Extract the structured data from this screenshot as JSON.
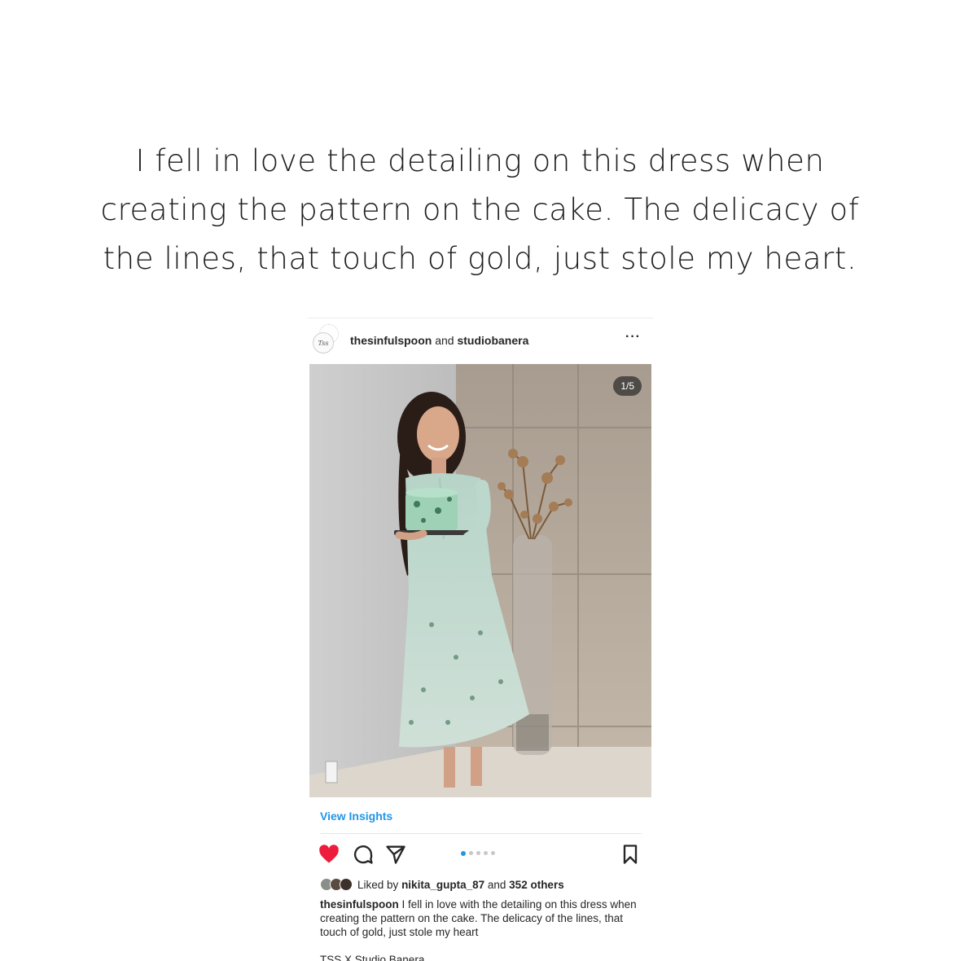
{
  "quote": {
    "text": "I fell in love the detailing on this dress when creating the pattern on the cake. The delicacy of the lines, that touch of gold, just stole my heart."
  },
  "post": {
    "username_primary": "thesinfulspoon",
    "username_joiner": "and",
    "username_secondary": "studiobanera",
    "avatar_text": "Tss",
    "more_icon": "···",
    "slide_counter": "1/5",
    "view_insights": "View Insights",
    "carousel": {
      "total": 5,
      "current": 1
    },
    "likes": {
      "prefix": "Liked by",
      "user": "nikita_gupta_87",
      "joiner": "and",
      "others": "352 others"
    },
    "caption": {
      "username": "thesinfulspoon",
      "text": "I fell in love with the detailing on this dress when creating the pattern on the cake. The delicacy of the lines, that touch of gold, just stole my heart"
    },
    "hashtag_line": "TSS X Studio Banera",
    "icons": {
      "heart": "heart-filled-icon",
      "comment": "comment-icon",
      "share": "send-icon",
      "save": "bookmark-icon"
    }
  },
  "colors": {
    "heart": "#ed1c3b",
    "insights": "#2196e8",
    "dot_active": "#2196e8",
    "text": "#262626"
  }
}
